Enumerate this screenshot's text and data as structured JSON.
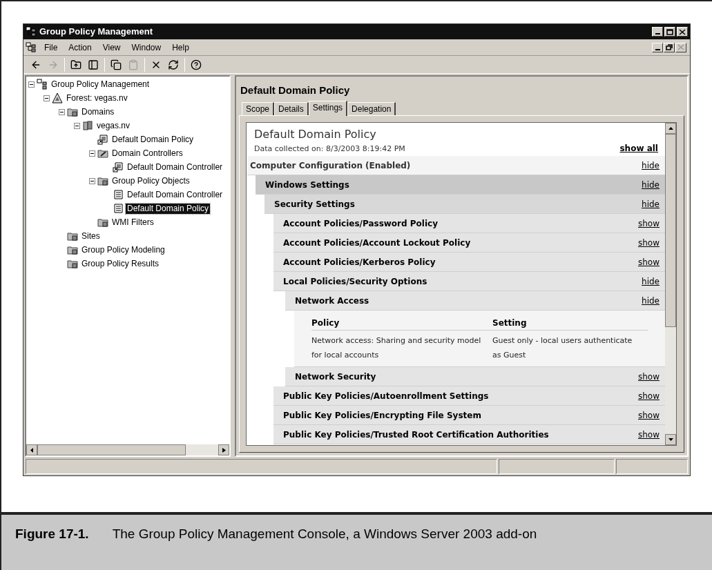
{
  "window": {
    "title": "Group Policy Management"
  },
  "menu": [
    {
      "label": "File"
    },
    {
      "label": "Action"
    },
    {
      "label": "View"
    },
    {
      "label": "Window"
    },
    {
      "label": "Help"
    }
  ],
  "toolbar": [
    {
      "kind": "back",
      "disabled": false
    },
    {
      "kind": "forward",
      "disabled": true
    },
    {
      "kind": "separator"
    },
    {
      "kind": "up",
      "disabled": false
    },
    {
      "kind": "tree",
      "disabled": false
    },
    {
      "kind": "separator"
    },
    {
      "kind": "copy",
      "disabled": false
    },
    {
      "kind": "paste",
      "disabled": true
    },
    {
      "kind": "separator"
    },
    {
      "kind": "delete",
      "disabled": false
    },
    {
      "kind": "refresh",
      "disabled": false
    },
    {
      "kind": "separator"
    },
    {
      "kind": "help",
      "disabled": false
    }
  ],
  "tree": [
    {
      "label": "Group Policy Management",
      "kind": "console",
      "selected": false,
      "expanded": true,
      "children": [
        {
          "label": "Forest: vegas.nv",
          "kind": "forest",
          "selected": false,
          "expanded": true,
          "children": [
            {
              "label": "Domains",
              "kind": "folder",
              "selected": false,
              "expanded": true,
              "children": [
                {
                  "label": "vegas.nv",
                  "kind": "domain",
                  "selected": false,
                  "expanded": true,
                  "children": [
                    {
                      "label": "Default Domain Policy",
                      "kind": "link",
                      "selected": false
                    },
                    {
                      "label": "Domain Controllers",
                      "kind": "ou",
                      "selected": false,
                      "expanded": true,
                      "children": [
                        {
                          "label": "Default Domain Controller",
                          "kind": "link",
                          "selected": false
                        }
                      ]
                    },
                    {
                      "label": "Group Policy Objects",
                      "kind": "folder",
                      "selected": false,
                      "expanded": true,
                      "children": [
                        {
                          "label": "Default Domain Controller",
                          "kind": "policy",
                          "selected": false
                        },
                        {
                          "label": "Default Domain Policy",
                          "kind": "policy",
                          "selected": true
                        }
                      ]
                    },
                    {
                      "label": "WMI Filters",
                      "kind": "folder",
                      "selected": false
                    }
                  ]
                }
              ]
            },
            {
              "label": "Sites",
              "kind": "folder",
              "selected": false
            },
            {
              "label": "Group Policy Modeling",
              "kind": "folder",
              "selected": false
            },
            {
              "label": "Group Policy Results",
              "kind": "folder",
              "selected": false
            }
          ]
        }
      ]
    }
  ],
  "details": {
    "title": "Default Domain Policy",
    "tabs": [
      {
        "label": "Scope",
        "selected": false
      },
      {
        "label": "Details",
        "selected": false
      },
      {
        "label": "Settings",
        "selected": true
      },
      {
        "label": "Delegation",
        "selected": false
      }
    ],
    "report": {
      "title": "Default Domain Policy",
      "collected": "Data collected on: 8/3/2003 8:19:42 PM",
      "show_all": "show all",
      "sections": [
        {
          "kind": "section",
          "title": "Computer Configuration (Enabled)",
          "link": "hide",
          "children": [
            {
              "kind": "section",
              "title": "Windows Settings",
              "link": "hide",
              "children": [
                {
                  "kind": "section",
                  "title": "Security Settings",
                  "link": "hide",
                  "children": [
                    {
                      "kind": "section",
                      "title": "Account Policies/Password Policy",
                      "link": "show"
                    },
                    {
                      "kind": "section",
                      "title": "Account Policies/Account Lockout Policy",
                      "link": "show"
                    },
                    {
                      "kind": "section",
                      "title": "Account Policies/Kerberos Policy",
                      "link": "show"
                    },
                    {
                      "kind": "section",
                      "title": "Local Policies/Security Options",
                      "link": "hide",
                      "children": [
                        {
                          "kind": "section",
                          "title": "Network Access",
                          "link": "hide",
                          "children": [
                            {
                              "kind": "table",
                              "columns": [
                                "Policy",
                                "Setting"
                              ],
                              "rows": [
                                [
                                  "Network access: Sharing and security model for local accounts",
                                  "Guest only - local users authenticate as Guest"
                                ]
                              ]
                            }
                          ]
                        },
                        {
                          "kind": "section",
                          "title": "Network Security",
                          "link": "show"
                        }
                      ]
                    },
                    {
                      "kind": "section",
                      "title": "Public Key Policies/Autoenrollment Settings",
                      "link": "show"
                    },
                    {
                      "kind": "section",
                      "title": "Public Key Policies/Encrypting File System",
                      "link": "show"
                    },
                    {
                      "kind": "section",
                      "title": "Public Key Policies/Trusted Root Certification Authorities",
                      "link": "show"
                    }
                  ]
                }
              ]
            }
          ]
        }
      ]
    }
  },
  "caption": {
    "label": "Figure 17-1.",
    "text": "The Group Policy Management Console, a Windows Server 2003 add-on"
  }
}
